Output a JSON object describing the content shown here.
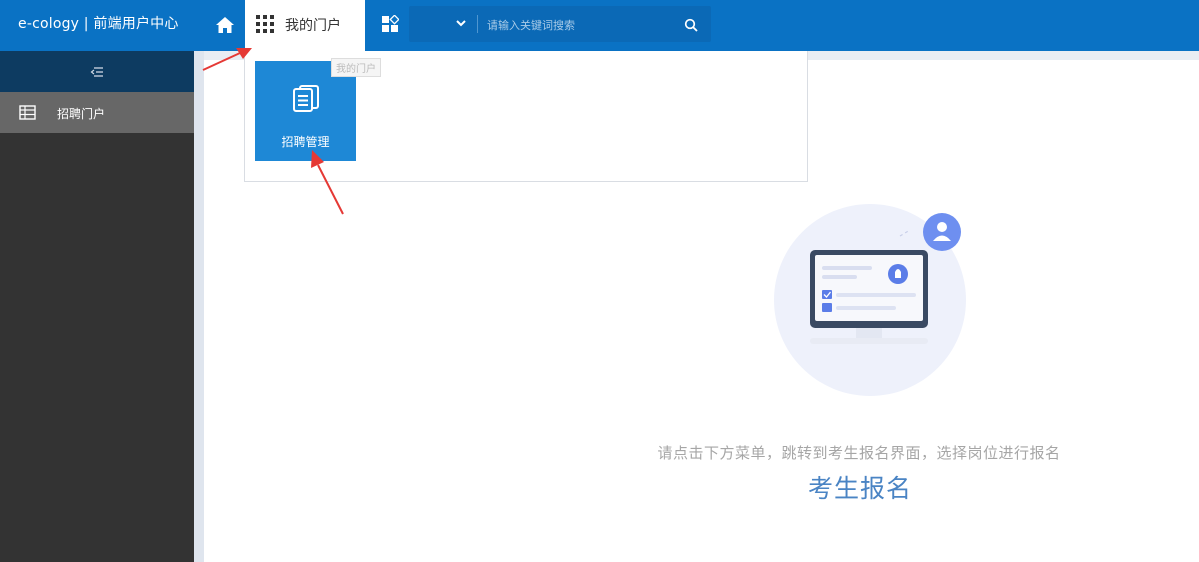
{
  "header": {
    "app_title": "e-cology | 前端用户中心",
    "home_icon": "home-icon",
    "portal_tab_label": "我的门户",
    "grid_icon": "grid-icon",
    "apps_icon": "apps-icon",
    "search": {
      "type_value": "",
      "placeholder": "请输入关键词搜索",
      "icon": "search-icon"
    }
  },
  "sidebar": {
    "toggle_icon": "collapse-menu-icon",
    "items": [
      {
        "label": "招聘门户",
        "icon": "table-icon"
      }
    ]
  },
  "dropdown": {
    "tooltip": "我的门户",
    "tiles": [
      {
        "label": "招聘管理",
        "icon": "documents-icon"
      }
    ]
  },
  "main": {
    "hint": "请点击下方菜单，跳转到考生报名界面，选择岗位进行报名",
    "register_link": "考生报名"
  },
  "colors": {
    "topbar": "#0a72c4",
    "sidebar": "#333333",
    "sidebar_active": "#676767",
    "tile": "#1e88d6",
    "link": "#4a84c4",
    "annotation_arrow": "#e53935"
  }
}
